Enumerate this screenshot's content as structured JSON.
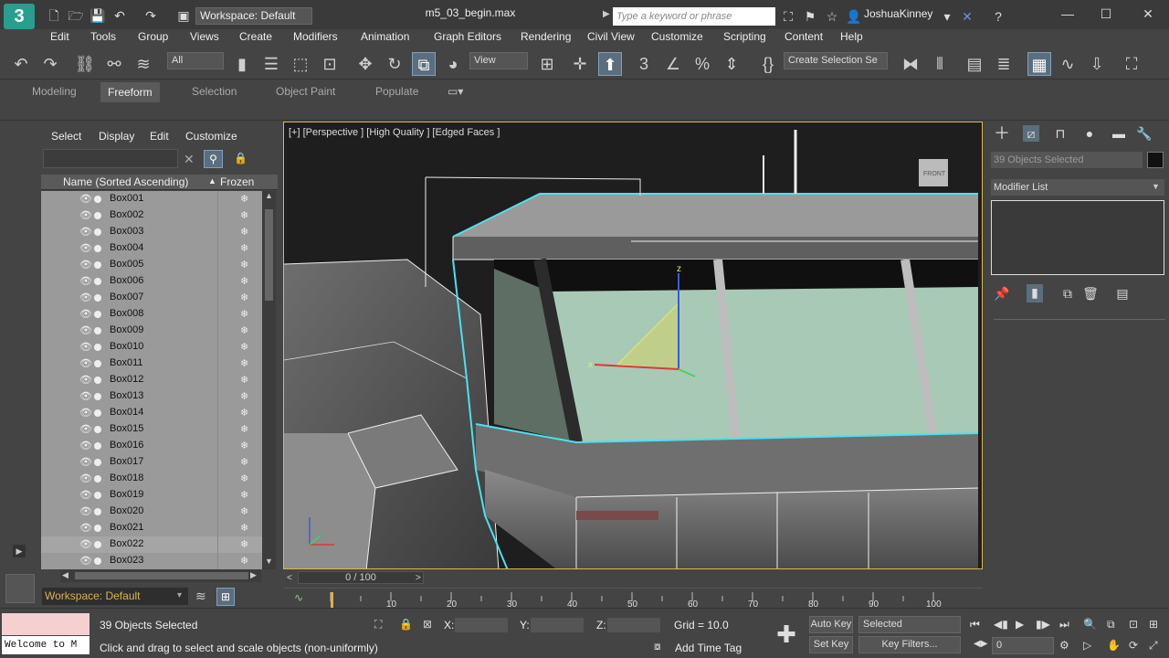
{
  "app": {
    "logo": "3",
    "workspace": "Workspace: Default",
    "file_title": "m5_03_begin.max",
    "search_placeholder": "Type a keyword or phrase",
    "user": "JoshuaKinney"
  },
  "menu": [
    "Edit",
    "Tools",
    "Group",
    "Views",
    "Create",
    "Modifiers",
    "Animation",
    "Graph Editors",
    "Rendering",
    "Civil View",
    "Customize",
    "Scripting",
    "Content",
    "Help"
  ],
  "toolbar": {
    "selection_filter": "All",
    "ref_coord": "View",
    "named_selection": "Create Selection Se"
  },
  "ribbon": {
    "tabs": [
      "Modeling",
      "Freeform",
      "Selection",
      "Object Paint",
      "Populate"
    ],
    "active_tab": "Freeform"
  },
  "scene_explorer": {
    "menu": [
      "Select",
      "Display",
      "Edit",
      "Customize"
    ],
    "col_name": "Name (Sorted Ascending)",
    "col_frozen": "Frozen",
    "sort_arrow": "▲",
    "rows": [
      "Box001",
      "Box002",
      "Box003",
      "Box004",
      "Box005",
      "Box006",
      "Box007",
      "Box008",
      "Box009",
      "Box010",
      "Box011",
      "Box012",
      "Box013",
      "Box014",
      "Box015",
      "Box016",
      "Box017",
      "Box018",
      "Box019",
      "Box020",
      "Box021",
      "Box022",
      "Box023"
    ],
    "selected_row": "Box022",
    "workspace": "Workspace: Default"
  },
  "viewport": {
    "label": "[+] [Perspective ] [High Quality ] [Edged Faces ]",
    "gizmo_axis_z": "z",
    "gizmo_axis_x": "x",
    "viewcube_label": "FRONT"
  },
  "command_panel": {
    "objects_selected": "39 Objects Selected",
    "modifier_list": "Modifier List"
  },
  "time_slider": {
    "frame": "0 / 100",
    "ticks": [
      "10",
      "20",
      "30",
      "40",
      "50",
      "60",
      "70",
      "80",
      "90",
      "100"
    ]
  },
  "status": {
    "maxscript": "Welcome to M",
    "objects_selected": "39 Objects Selected",
    "prompt": "Click and drag to select and scale objects (non-uniformly)",
    "x_label": "X:",
    "y_label": "Y:",
    "z_label": "Z:",
    "grid": "Grid = 10.0",
    "add_time_tag": "Add Time Tag",
    "auto_key": "Auto Key",
    "set_key": "Set Key",
    "key_mode": "Selected",
    "key_filters": "Key Filters...",
    "current_frame": "0"
  }
}
